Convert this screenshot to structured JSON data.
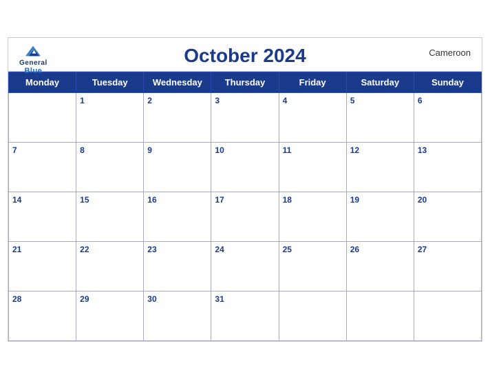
{
  "header": {
    "title": "October 2024",
    "country": "Cameroon",
    "logo_general": "General",
    "logo_blue": "Blue"
  },
  "weekdays": [
    "Monday",
    "Tuesday",
    "Wednesday",
    "Thursday",
    "Friday",
    "Saturday",
    "Sunday"
  ],
  "weeks": [
    [
      null,
      1,
      2,
      3,
      4,
      5,
      6
    ],
    [
      7,
      8,
      9,
      10,
      11,
      12,
      13
    ],
    [
      14,
      15,
      16,
      17,
      18,
      19,
      20
    ],
    [
      21,
      22,
      23,
      24,
      25,
      26,
      27
    ],
    [
      28,
      29,
      30,
      31,
      null,
      null,
      null
    ]
  ]
}
